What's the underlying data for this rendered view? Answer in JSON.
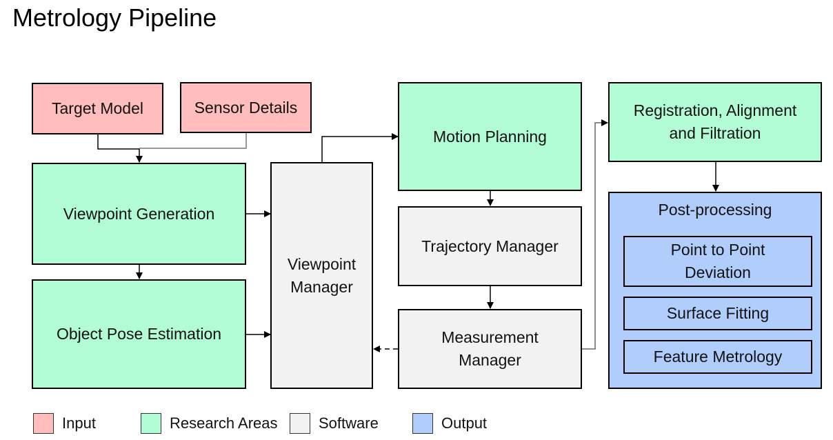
{
  "title": "Metrology Pipeline",
  "colors": {
    "input": "#ffbdbd",
    "research": "#b2fcd5",
    "software": "#f2f2f2",
    "output": "#b0cdfc"
  },
  "nodes": {
    "target_model": "Target Model",
    "sensor_details": "Sensor Details",
    "viewpoint_generation": "Viewpoint Generation",
    "object_pose_estimation": "Object Pose Estimation",
    "viewpoint_manager": [
      "Viewpoint",
      "Manager"
    ],
    "motion_planning": "Motion Planning",
    "trajectory_manager": "Trajectory Manager",
    "measurement_manager": [
      "Measurement",
      "Manager"
    ],
    "registration": [
      "Registration, Alignment",
      "and Filtration"
    ],
    "post_processing": {
      "title": "Post-processing",
      "items": [
        [
          "Point to Point",
          "Deviation"
        ],
        [
          "Surface Fitting"
        ],
        [
          "Feature Metrology"
        ]
      ]
    }
  },
  "edges": [
    {
      "from": "Target Model",
      "to": "Viewpoint Generation",
      "style": "solid"
    },
    {
      "from": "Sensor Details",
      "to": "Viewpoint Generation",
      "style": "solid"
    },
    {
      "from": "Viewpoint Generation",
      "to": "Object Pose Estimation",
      "style": "solid"
    },
    {
      "from": "Viewpoint Generation",
      "to": "Viewpoint Manager",
      "style": "solid"
    },
    {
      "from": "Object Pose Estimation",
      "to": "Viewpoint Manager",
      "style": "solid"
    },
    {
      "from": "Viewpoint Manager",
      "to": "Motion Planning",
      "style": "solid"
    },
    {
      "from": "Motion Planning",
      "to": "Trajectory Manager",
      "style": "solid"
    },
    {
      "from": "Trajectory Manager",
      "to": "Measurement Manager",
      "style": "solid"
    },
    {
      "from": "Measurement Manager",
      "to": "Viewpoint Manager",
      "style": "dashed"
    },
    {
      "from": "Measurement Manager",
      "to": "Registration, Alignment and Filtration",
      "style": "solid"
    },
    {
      "from": "Registration, Alignment and Filtration",
      "to": "Post-processing",
      "style": "solid"
    }
  ],
  "legend": [
    {
      "label": "Input",
      "color": "#ffbdbd"
    },
    {
      "label": "Research Areas",
      "color": "#b2fcd5"
    },
    {
      "label": "Software",
      "color": "#f2f2f2"
    },
    {
      "label": "Output",
      "color": "#b0cdfc"
    }
  ]
}
